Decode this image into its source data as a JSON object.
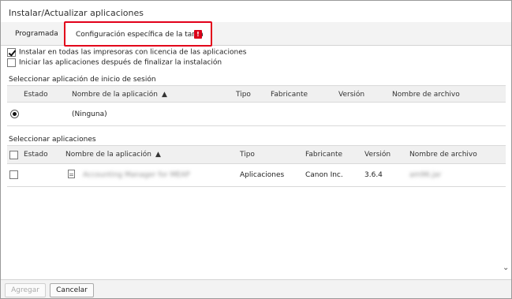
{
  "window": {
    "title": "Instalar/Actualizar aplicaciones"
  },
  "tabs": [
    {
      "label": "Programada"
    },
    {
      "label": "Configuración específica de la tarea",
      "badge": "!"
    }
  ],
  "options": [
    {
      "label": "Instalar en todas las impresoras con licencia de las aplicaciones",
      "checked": true
    },
    {
      "label": "Iniciar las aplicaciones después de finalizar la instalación",
      "checked": false
    }
  ],
  "login_app": {
    "section_label": "Seleccionar aplicación de inicio de sesión",
    "columns": [
      "Estado",
      "Nombre de la aplicación",
      "Tipo",
      "Fabricante",
      "Versión",
      "Nombre de archivo"
    ],
    "rows": [
      {
        "name": "(Ninguna)",
        "selected": true
      }
    ]
  },
  "apps": {
    "section_label": "Seleccionar aplicaciones",
    "columns": [
      "Estado",
      "Nombre de la aplicación",
      "Tipo",
      "Fabricante",
      "Versión",
      "Nombre de archivo"
    ],
    "rows": [
      {
        "name": "Accounting Manager for MEAP",
        "type": "Aplicaciones",
        "maker": "Canon Inc.",
        "version": "3.6.4",
        "file": "am96.jar"
      }
    ]
  },
  "buttons": {
    "add": "Agregar",
    "cancel": "Cancelar"
  },
  "colors": {
    "accent": "#e2001a",
    "header_bg": "#f0f0f0"
  },
  "icons": {
    "scroll_down": "chevron-down-icon"
  }
}
